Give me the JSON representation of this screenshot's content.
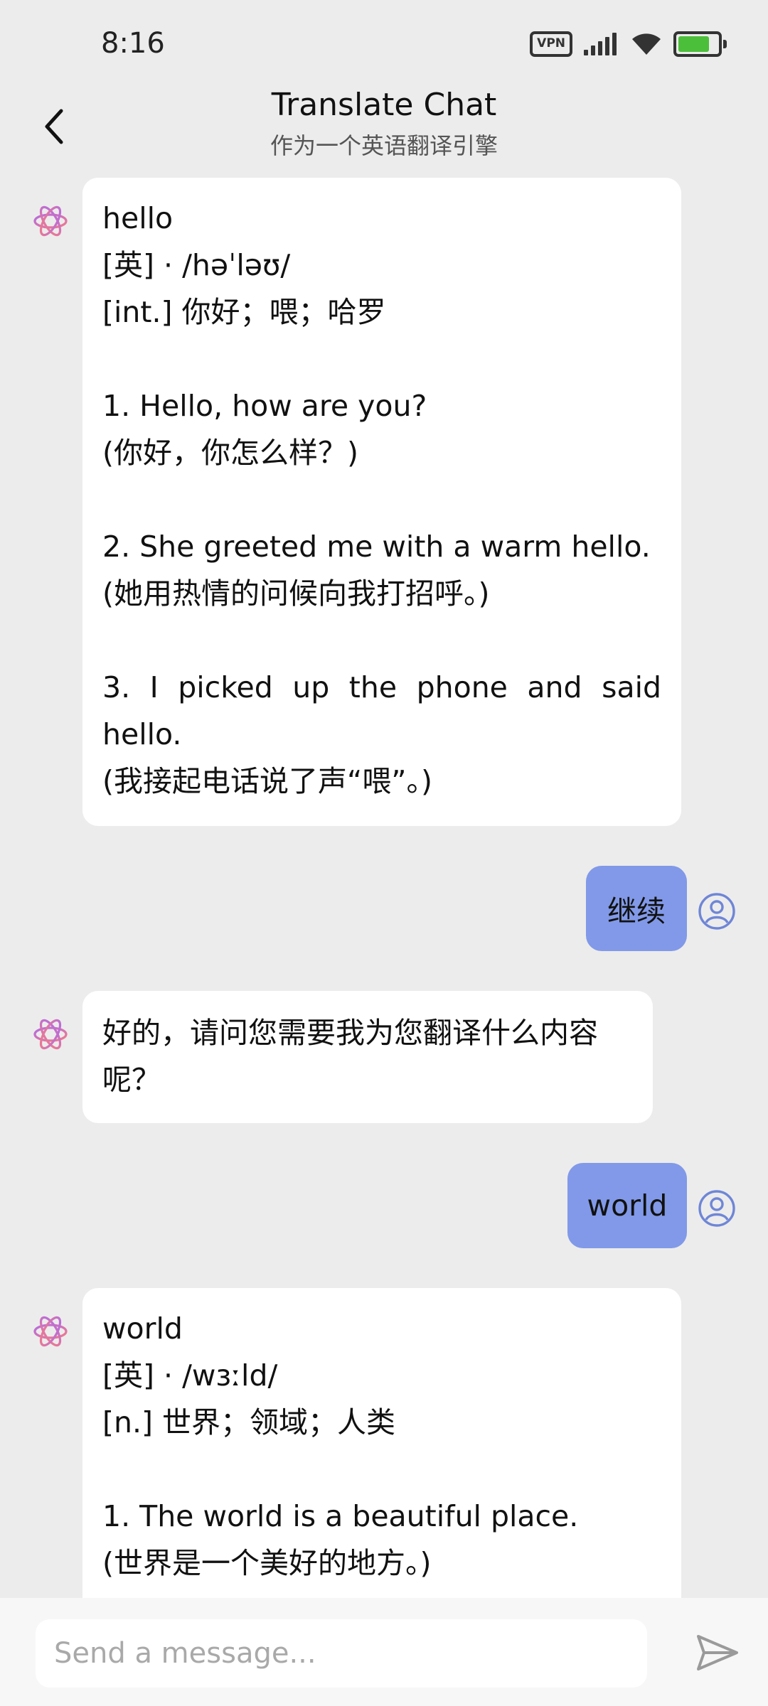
{
  "status_bar": {
    "time": "8:16",
    "vpn_label": "VPN",
    "battery_level": 0.8,
    "battery_color": "#4cbf3a"
  },
  "header": {
    "title": "Translate Chat",
    "subtitle": "作为一个英语翻译引擎",
    "back_icon": "chevron-left-icon"
  },
  "messages": [
    {
      "role": "assistant",
      "lines": [
        "hello",
        "[英] · /həˈləʊ/",
        "[int.] 你好；喂；哈罗",
        "",
        "1. Hello, how are you?",
        "(你好，你怎么样？)",
        "",
        "2. She greeted me with a warm hello.",
        "(她用热情的问候向我打招呼。)",
        "",
        "3. I picked up the phone and said hello.",
        "(我接起电话说了声“喂”。)"
      ]
    },
    {
      "role": "user",
      "text": "继续"
    },
    {
      "role": "assistant",
      "lines": [
        "好的，请问您需要我为您翻译什么内容呢？"
      ]
    },
    {
      "role": "user",
      "text": "world"
    },
    {
      "role": "assistant",
      "lines": [
        "world",
        "[英] · /wɜːld/",
        "[n.] 世界；领域；人类",
        "",
        "1. The world is a beautiful place.",
        "(世界是一个美好的地方。)"
      ]
    }
  ],
  "input": {
    "placeholder": "Send a message..."
  },
  "colors": {
    "background": "#ececec",
    "user_bubble": "#8199e8",
    "assistant_bubble": "#ffffff",
    "user_avatar": "#6f86d6"
  },
  "icons": {
    "assistant_avatar": "openai-logo-icon",
    "user_avatar": "user-circle-icon",
    "send": "send-icon"
  }
}
